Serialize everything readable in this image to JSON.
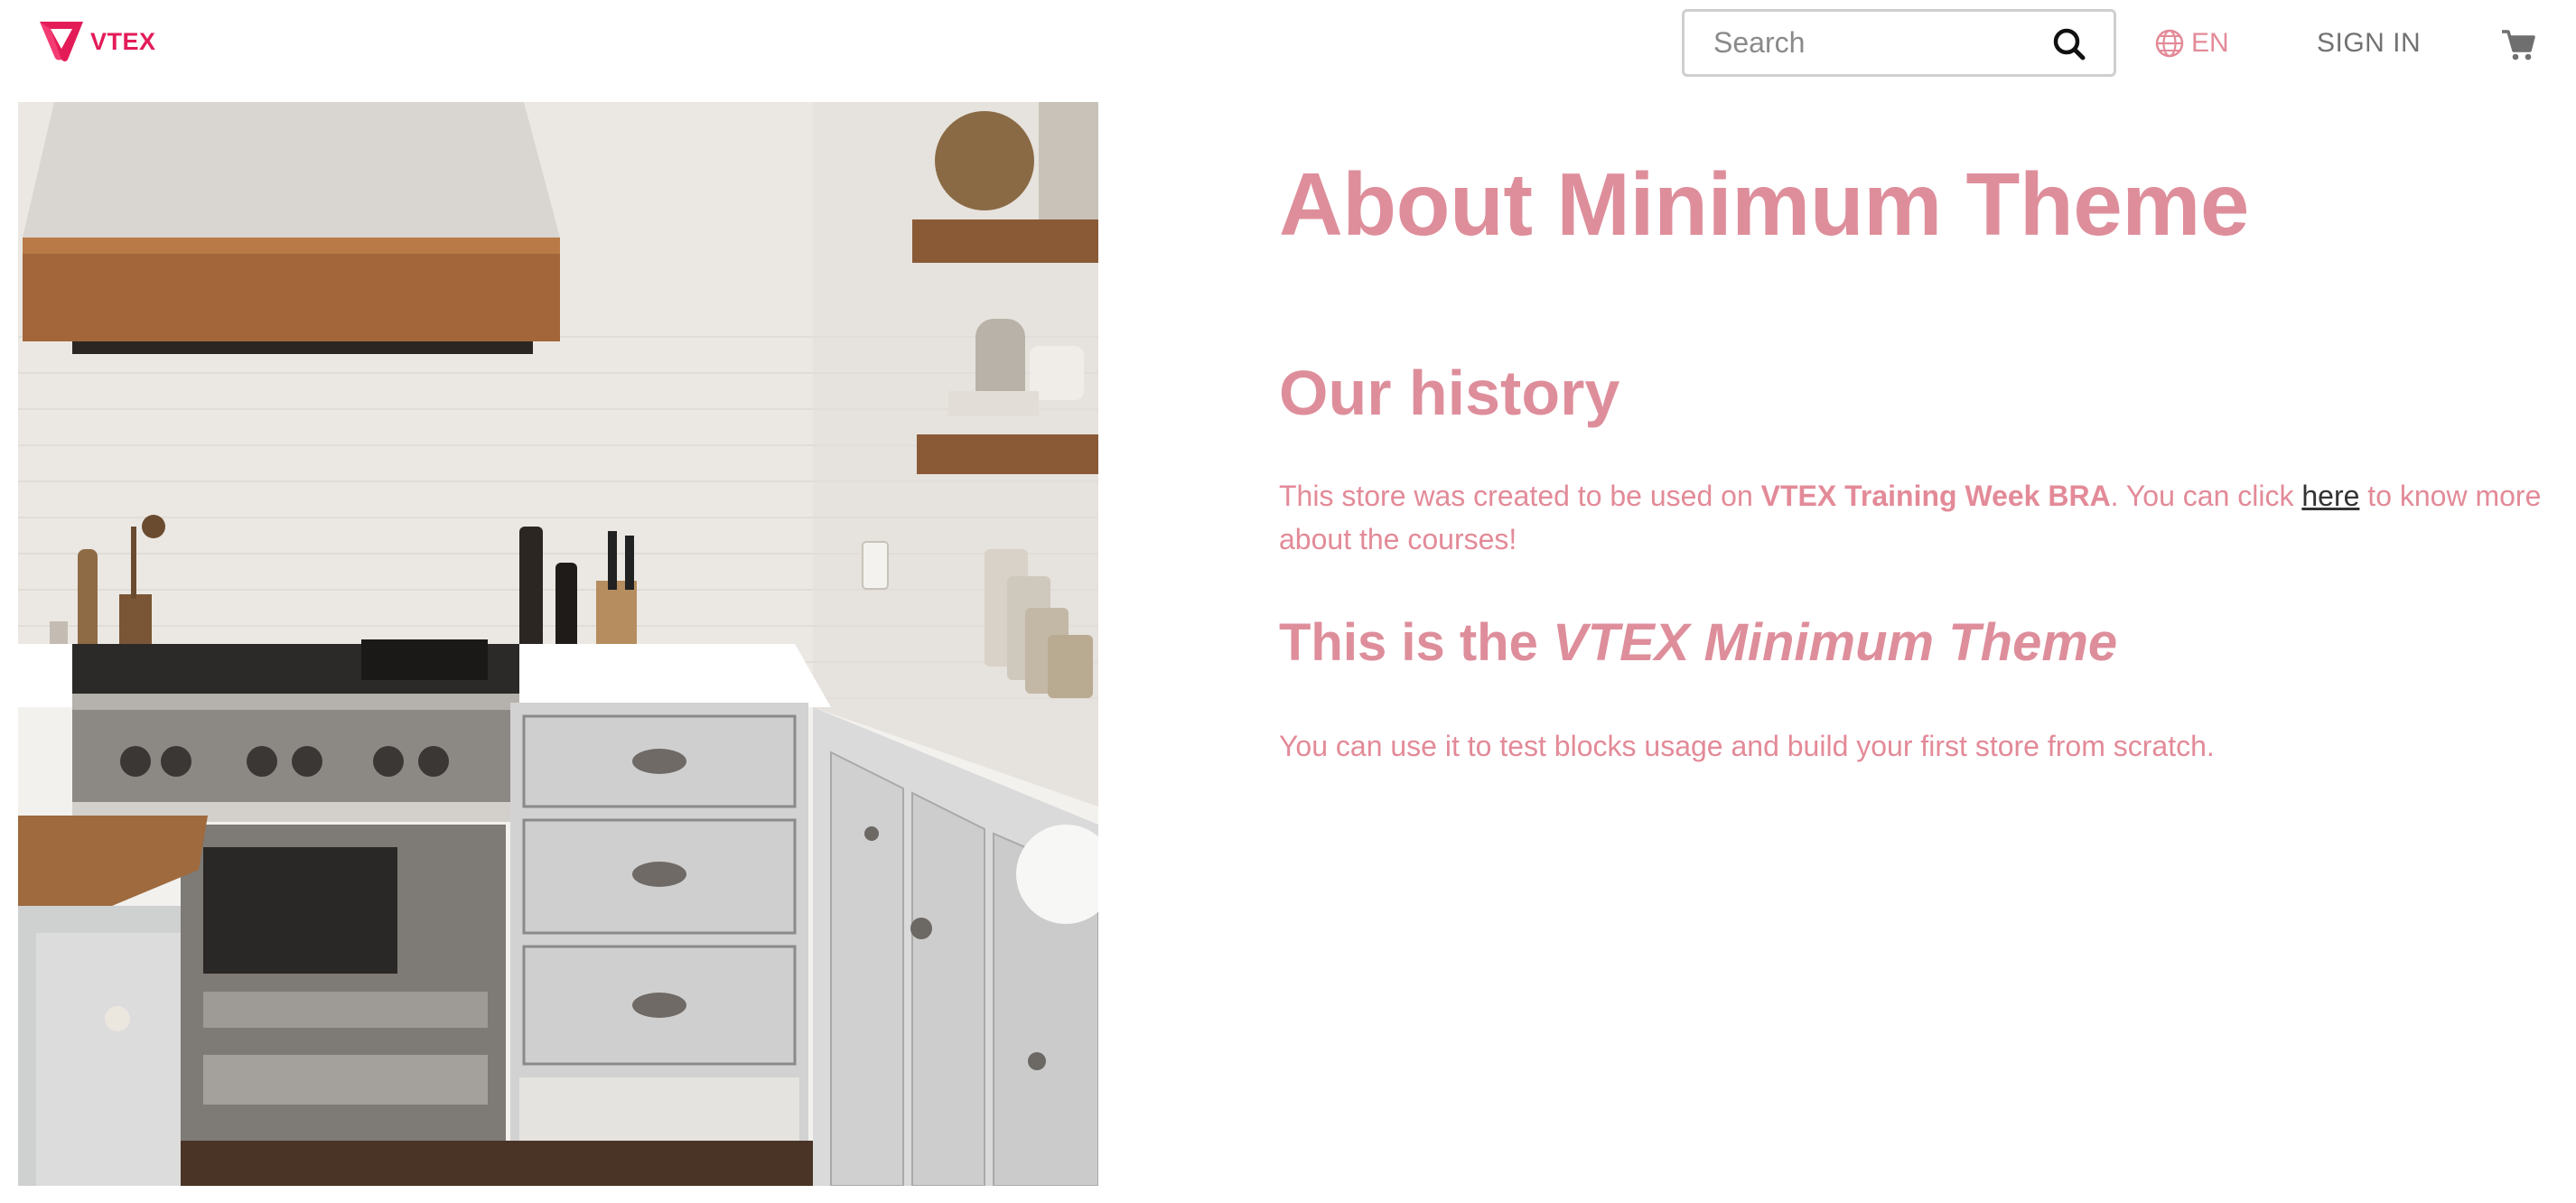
{
  "header": {
    "logo_text": "VTEX",
    "search_placeholder": "Search",
    "language": "EN",
    "sign_in": "SIGN IN",
    "icons": [
      "vtex-logo-icon",
      "search-icon",
      "globe-icon",
      "cart-icon"
    ]
  },
  "hero": {
    "image": "kitchen-photo"
  },
  "content": {
    "title": "About Minimum Theme",
    "history_heading": "Our history",
    "history_p1": "This store was created to be used on ",
    "history_bold": "VTEX Training Week BRA",
    "history_p2": ". You can click ",
    "history_link": "here",
    "history_p3": " to know more about the courses!",
    "theme_heading_prefix": "This is the ",
    "theme_heading_italic": "VTEX Minimum Theme",
    "theme_text": "You can use it to test blocks usage and build your first store from scratch."
  },
  "colors": {
    "brand": "#e31c58",
    "accent_pink": "#de8e9b",
    "link": "#333333"
  }
}
